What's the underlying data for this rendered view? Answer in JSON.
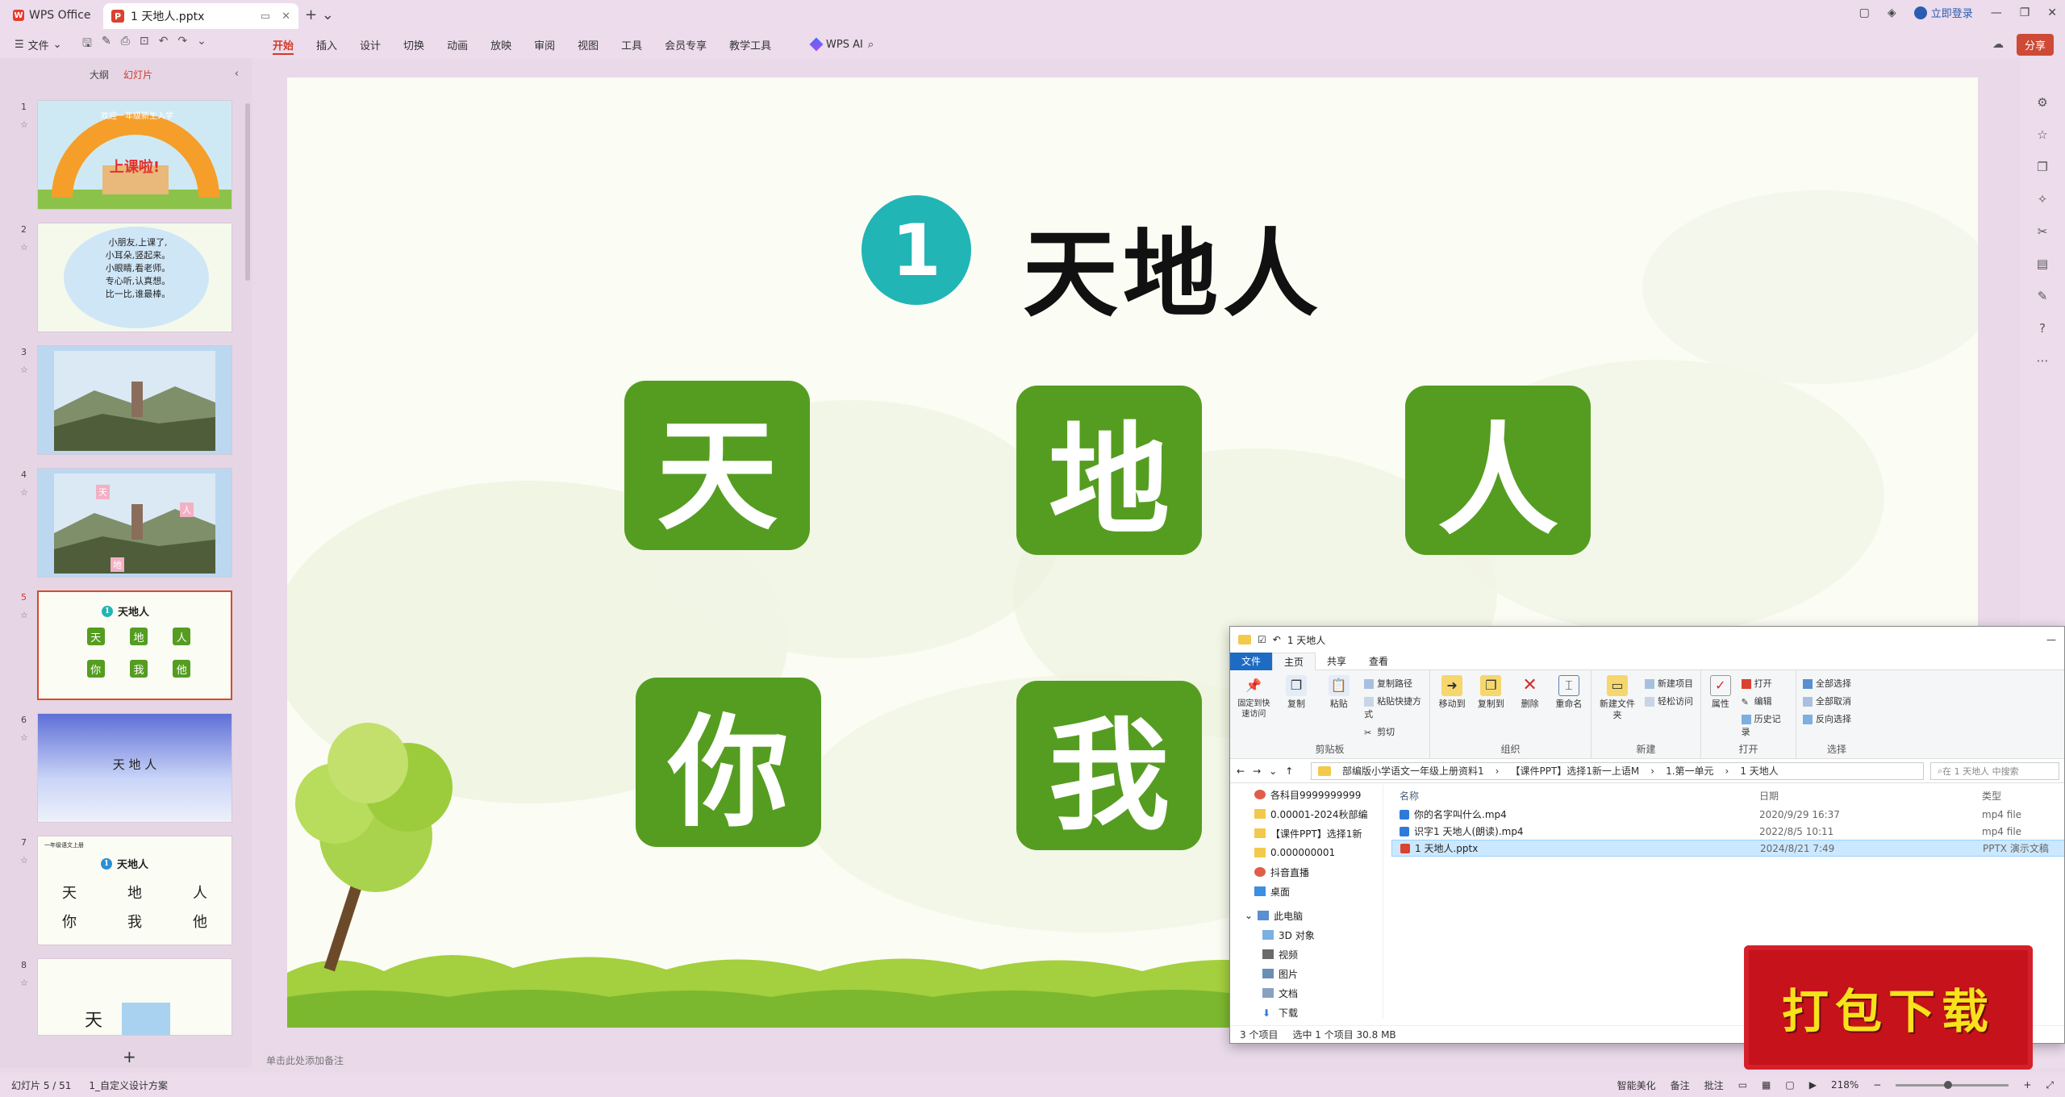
{
  "titlebar": {
    "app_tab": "WPS Office",
    "doc_tab": "1 天地人.pptx",
    "login": "立即登录"
  },
  "menubar": {
    "file": "文件",
    "tabs": [
      "开始",
      "插入",
      "设计",
      "切换",
      "动画",
      "放映",
      "审阅",
      "视图",
      "工具",
      "会员专享",
      "教学工具"
    ],
    "active_tab": "开始",
    "wps_ai": "WPS AI",
    "share": "分享"
  },
  "left_panel": {
    "tab_outline": "大纲",
    "tab_slides": "幻灯片",
    "slides": [
      {
        "num": "1",
        "title_text": "上课啦!",
        "arc_text": "欢迎一年级新生入学"
      },
      {
        "num": "2",
        "lines": [
          "小朋友,上课了,",
          "小耳朵,竖起来。",
          "小眼睛,看老师。",
          "专心听,认真想。",
          "比一比,谁最棒。"
        ]
      },
      {
        "num": "3"
      },
      {
        "num": "4",
        "chars": [
          "天",
          "人",
          "地"
        ]
      },
      {
        "num": "5",
        "title": "天地人",
        "chars": [
          "天",
          "地",
          "人",
          "你",
          "我",
          "他"
        ]
      },
      {
        "num": "6",
        "title": "天 地 人"
      },
      {
        "num": "7",
        "header": "一年级语文上册",
        "title": "天地人",
        "row1": [
          "天",
          "地",
          "人"
        ],
        "row2": [
          "你",
          "我",
          "他"
        ]
      },
      {
        "num": "8",
        "chars": [
          "天"
        ]
      }
    ]
  },
  "slide": {
    "number": "1",
    "title": "天地人",
    "chars": [
      "天",
      "地",
      "人",
      "你",
      "我"
    ],
    "colors": {
      "tile": "#559d21",
      "badge": "#21b5b5"
    }
  },
  "notes_placeholder": "单击此处添加备注",
  "statusbar": {
    "slide_count": "幻灯片 5 / 51",
    "theme": "1_自定义设计方案",
    "beautify": "智能美化",
    "notes": "备注",
    "comments": "批注",
    "zoom": "218%"
  },
  "explorer": {
    "title": "1 天地人",
    "tabs": [
      "文件",
      "主页",
      "共享",
      "查看"
    ],
    "ribbon": {
      "clipboard": {
        "label": "剪贴板",
        "pin": "固定到快速访问",
        "copy": "复制",
        "paste": "粘贴",
        "copy_path": "复制路径",
        "paste_shortcut": "粘贴快捷方式",
        "cut": "剪切"
      },
      "organize": {
        "label": "组织",
        "move_to": "移动到",
        "copy_to": "复制到",
        "delete": "删除",
        "rename": "重命名"
      },
      "new": {
        "label": "新建",
        "new_folder": "新建文件夹",
        "new_item": "新建项目",
        "easy_access": "轻松访问"
      },
      "open": {
        "label": "打开",
        "properties": "属性",
        "open": "打开",
        "edit": "编辑",
        "history": "历史记录"
      },
      "select": {
        "label": "选择",
        "select_all": "全部选择",
        "select_none": "全部取消",
        "invert": "反向选择"
      }
    },
    "address": [
      "部编版小学语文一年级上册资料1",
      "【课件PPT】选择1新一上语M",
      "1.第一单元",
      "1 天地人"
    ],
    "search_placeholder": "在 1 天地人 中搜索",
    "nav": [
      "各科目9999999999",
      "0.00001-2024秋部编",
      "【课件PPT】选择1新",
      "0.000000001",
      "抖音直播",
      "桌面",
      "此电脑",
      "3D 对象",
      "视频",
      "图片",
      "文档",
      "下载"
    ],
    "columns": {
      "name": "名称",
      "date": "日期",
      "type": "类型"
    },
    "files": [
      {
        "name": "你的名字叫什么.mp4",
        "date": "2020/9/29 16:37",
        "type": "mp4 file",
        "kind": "mp4"
      },
      {
        "name": "识字1 天地人(朗读).mp4",
        "date": "2022/8/5 10:11",
        "type": "mp4 file",
        "kind": "mp4"
      },
      {
        "name": "1 天地人.pptx",
        "date": "2024/8/21 7:49",
        "type": "PPTX 演示文稿",
        "kind": "pptx"
      }
    ],
    "status_items": "3 个项目",
    "status_selected": "选中 1 个项目  30.8 MB"
  },
  "download_badge": "打包下载"
}
